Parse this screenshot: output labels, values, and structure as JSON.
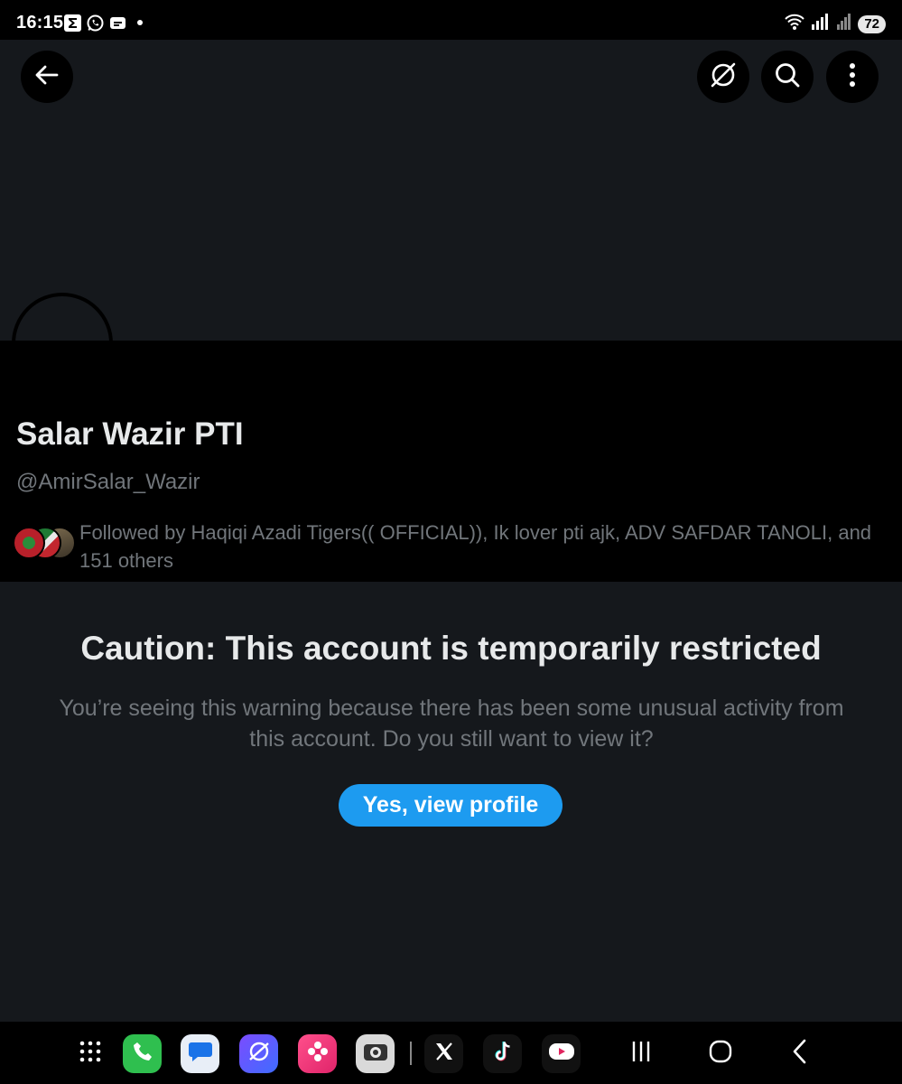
{
  "status_bar": {
    "time": "16:15",
    "notification_icons": [
      "sigma-icon",
      "whatsapp-icon",
      "message-icon",
      "dot-icon"
    ],
    "battery": "72"
  },
  "header": {
    "back_icon": "back-arrow-icon",
    "actions": [
      "grok-off-icon",
      "search-icon",
      "more-vertical-icon"
    ]
  },
  "profile": {
    "display_name": "Salar Wazir PTI",
    "handle": "@AmirSalar_Wazir",
    "followed_by": "Followed by Haqiqi Azadi Tigers(( OFFICIAL)), Ik lover pti ajk, ADV SAFDAR TANOLI, and 151 others"
  },
  "warning": {
    "title": "Caution: This account is temporarily restricted",
    "body": "You’re seeing this warning because there has been some unusual activity from this account. Do you still want to view it?",
    "button_label": "Yes, view profile"
  },
  "colors": {
    "background": "#15181c",
    "profile_bg": "#000000",
    "accent": "#1d9bf0",
    "secondary_text": "#71767b"
  },
  "nav_bar": {
    "apps": [
      "app-drawer-icon",
      "phone-icon",
      "messages-icon",
      "internet-icon",
      "gallery-icon",
      "camera-icon",
      "x-app-icon",
      "tiktok-icon",
      "video-player-icon"
    ],
    "system": [
      "recents-icon",
      "home-icon",
      "back-icon"
    ]
  }
}
